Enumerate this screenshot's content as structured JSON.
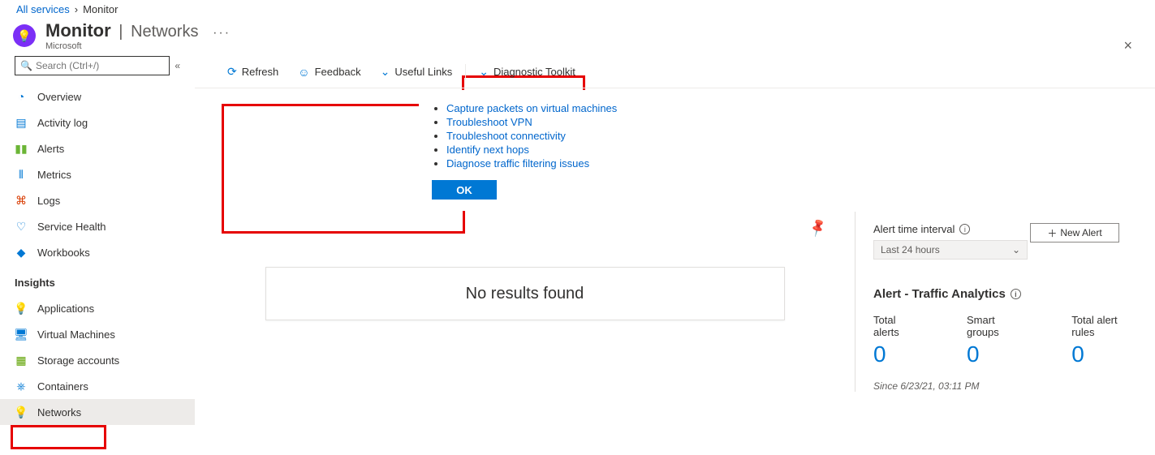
{
  "breadcrumb": {
    "root": "All services",
    "current": "Monitor"
  },
  "header": {
    "title": "Monitor",
    "section": "Networks",
    "company": "Microsoft",
    "more": "···",
    "close": "×"
  },
  "search": {
    "placeholder": "Search (Ctrl+/)"
  },
  "sidebar": {
    "items": [
      {
        "label": "Overview",
        "icon": "◔",
        "color": "#0078d4"
      },
      {
        "label": "Activity log",
        "icon": "▤",
        "color": "#0078d4"
      },
      {
        "label": "Alerts",
        "icon": "▮▮",
        "color": "#6bb536"
      },
      {
        "label": "Metrics",
        "icon": "⫴",
        "color": "#0078d4"
      },
      {
        "label": "Logs",
        "icon": "⌘",
        "color": "#d83b01"
      },
      {
        "label": "Service Health",
        "icon": "♡",
        "color": "#0078d4"
      },
      {
        "label": "Workbooks",
        "icon": "◆",
        "color": "#0078d4"
      }
    ],
    "insights_header": "Insights",
    "insights": [
      {
        "label": "Applications",
        "icon": "💡",
        "color": "#8661c5"
      },
      {
        "label": "Virtual Machines",
        "icon": "🖥",
        "color": "#0078d4"
      },
      {
        "label": "Storage accounts",
        "icon": "▦",
        "color": "#5ea200"
      },
      {
        "label": "Containers",
        "icon": "⎈",
        "color": "#0078d4"
      },
      {
        "label": "Networks",
        "icon": "💡",
        "color": "#8661c5",
        "active": true
      }
    ]
  },
  "toolbar": {
    "refresh": "Refresh",
    "feedback": "Feedback",
    "useful_links": "Useful Links",
    "diag_toolkit": "Diagnostic Toolkit"
  },
  "toolkit_menu": {
    "items": [
      "Capture packets on virtual machines",
      "Troubleshoot VPN",
      "Troubleshoot connectivity",
      "Identify next hops",
      "Diagnose traffic filtering issues"
    ],
    "ok": "OK"
  },
  "content": {
    "no_results": "No results found"
  },
  "right": {
    "interval_label": "Alert time interval",
    "interval_value": "Last 24 hours",
    "new_alert": "New Alert",
    "section_title": "Alert - Traffic Analytics",
    "stats": [
      {
        "label": "Total alerts",
        "value": "0"
      },
      {
        "label": "Smart groups",
        "value": "0"
      },
      {
        "label": "Total alert rules",
        "value": "0"
      }
    ],
    "since": "Since 6/23/21, 03:11 PM"
  }
}
